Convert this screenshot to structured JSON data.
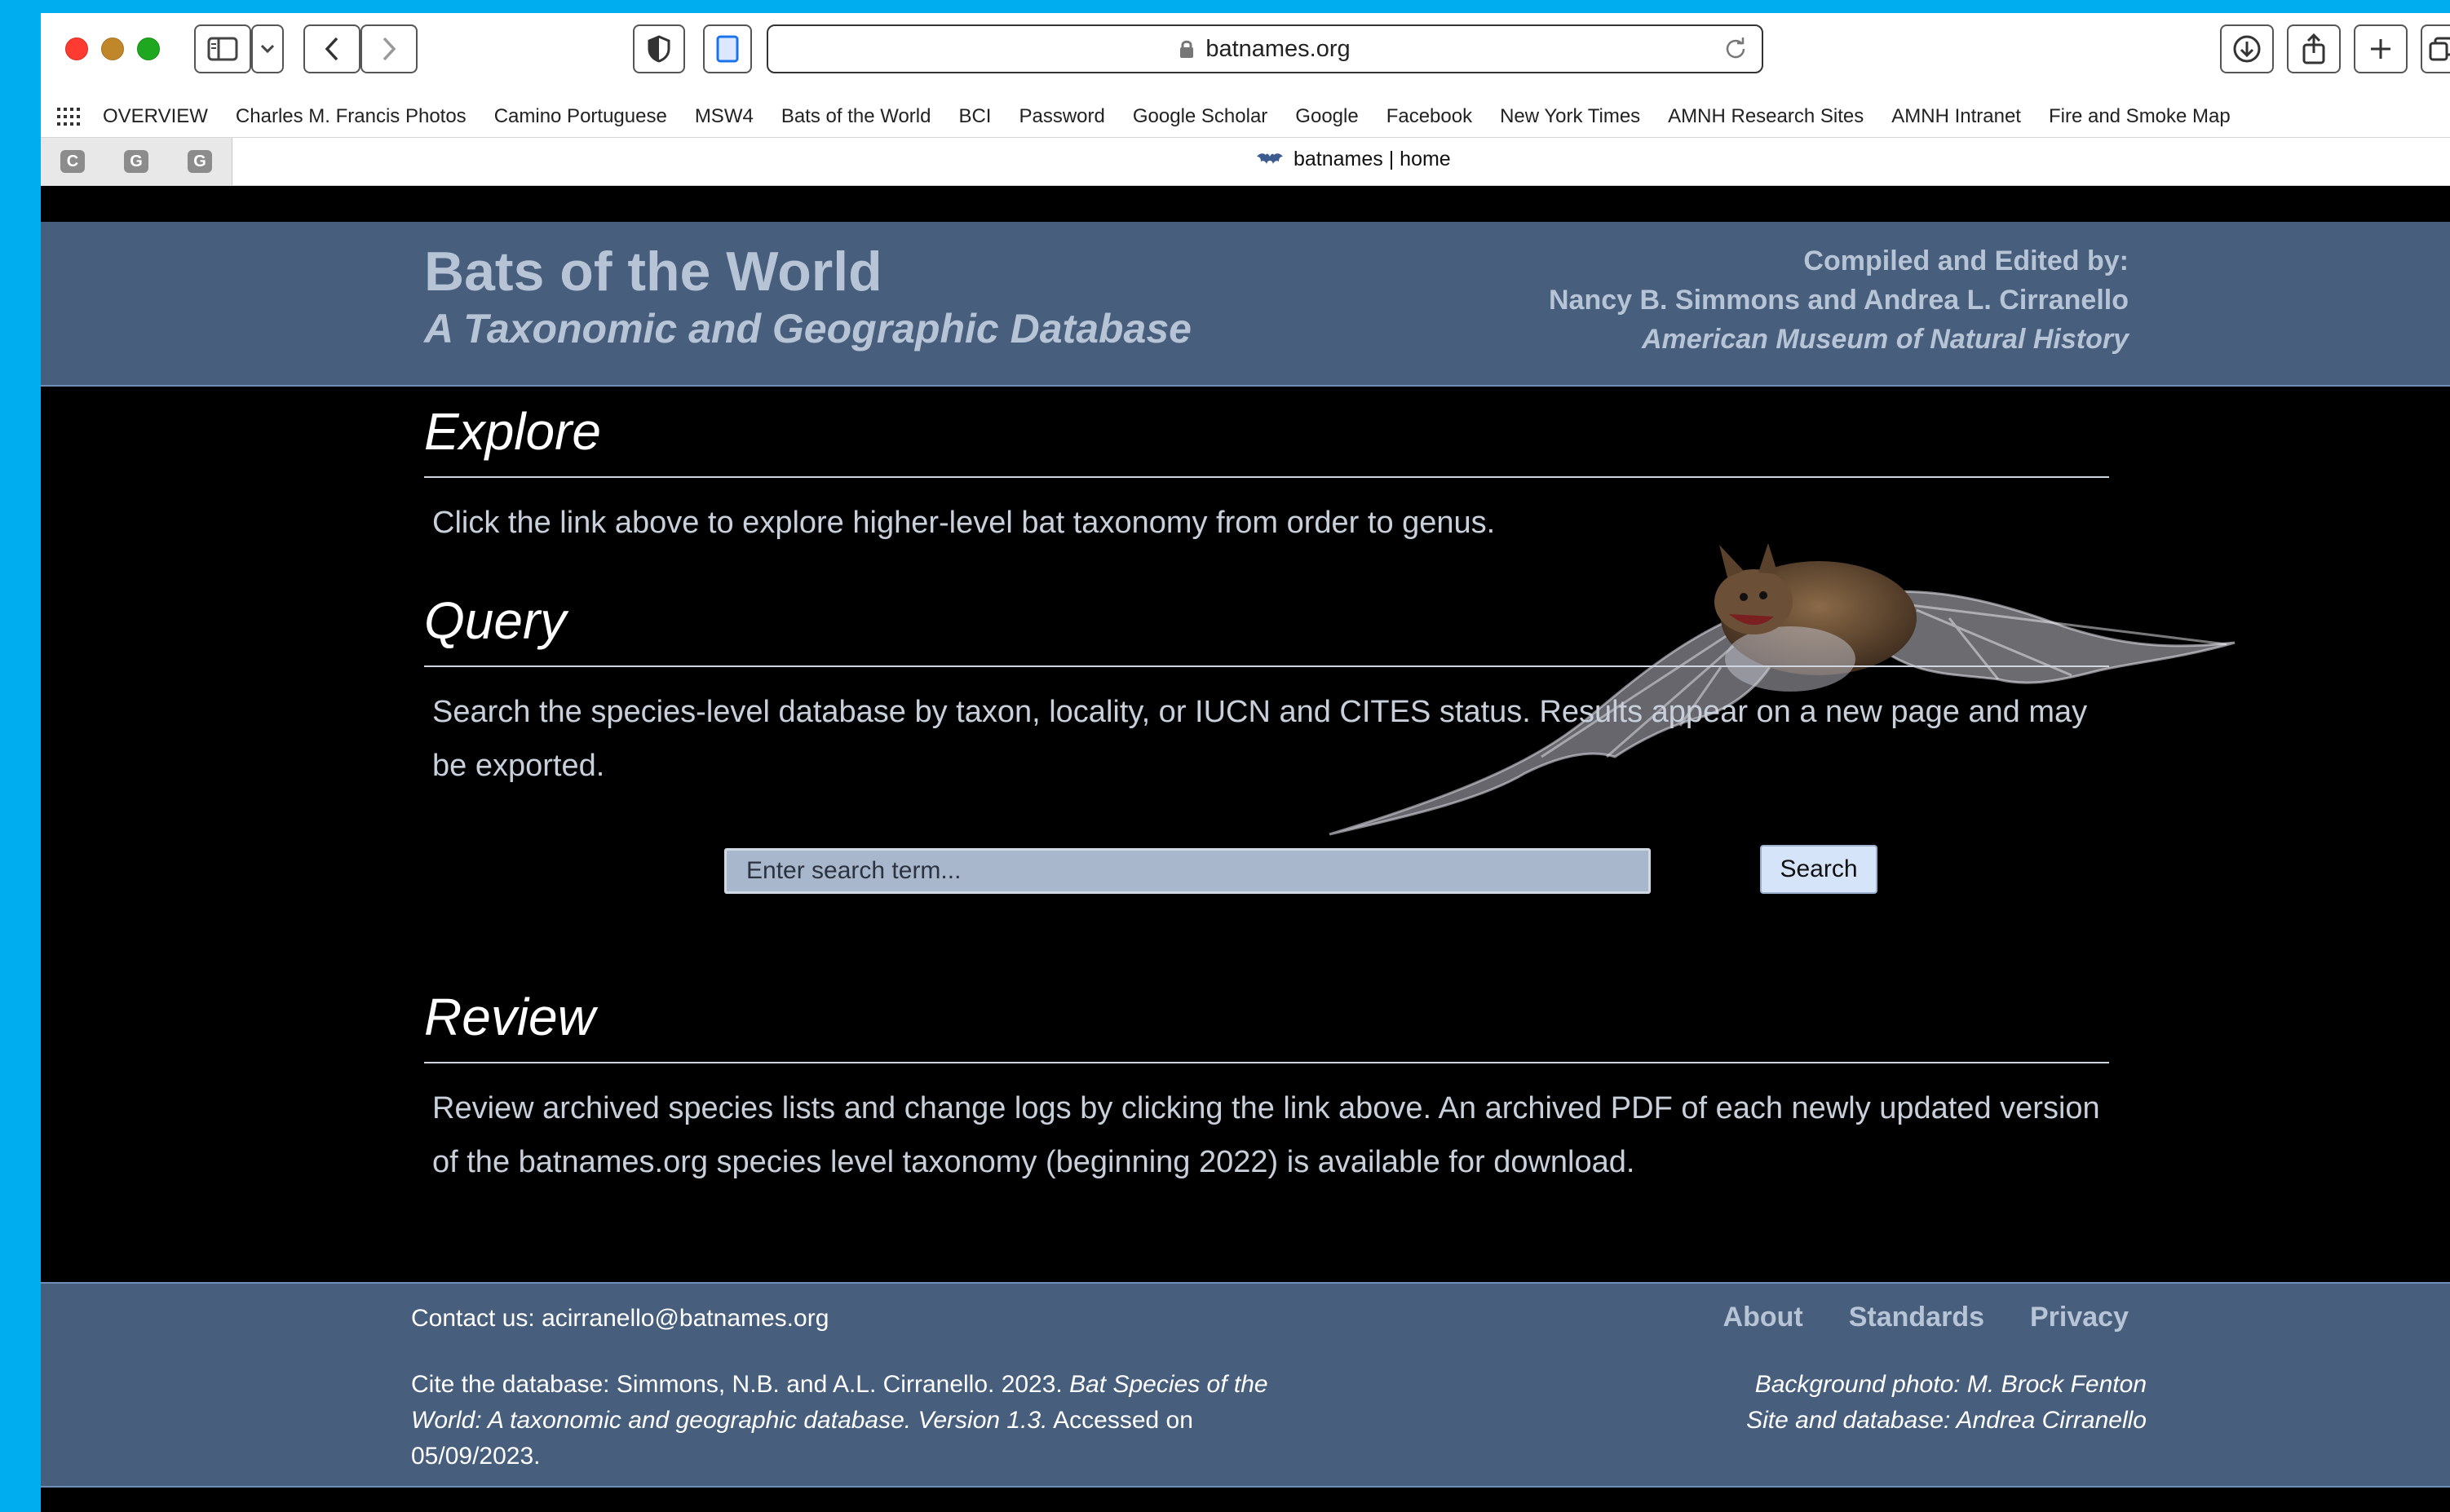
{
  "browser": {
    "address": "batnames.org",
    "bookmarks": [
      "OVERVIEW",
      "Charles M. Francis Photos",
      "Camino Portuguese",
      "MSW4",
      "Bats of the World",
      "BCI",
      "Password",
      "Google Scholar",
      "Google",
      "Facebook",
      "New York Times",
      "AMNH Research Sites",
      "AMNH Intranet",
      "Fire and Smoke Map"
    ],
    "pinned_tabs": [
      "C",
      "G",
      "G"
    ],
    "active_tab_title": "batnames | home",
    "colors": {
      "desktop": "#00aeef",
      "close": "#fe3b30",
      "minimize": "#c0862a",
      "zoom": "#1fa81f"
    }
  },
  "header": {
    "title": "Bats of the World",
    "subtitle": "A Taxonomic and Geographic Database",
    "credits_heading": "Compiled and Edited by:",
    "credits_names": "Nancy B. Simmons and Andrea L. Cirranello",
    "credits_institution": "American Museum of Natural History",
    "band_color": "#475e7c"
  },
  "sections": {
    "explore": {
      "title": "Explore",
      "text": "Click the link above to explore higher-level bat taxonomy from order to genus."
    },
    "query": {
      "title": "Query",
      "text": "Search the species-level database by taxon, locality, or IUCN and CITES status. Results appear on a new page and may be exported."
    },
    "review": {
      "title": "Review",
      "text": "Review archived species lists and change logs by clicking the link above. An archived PDF of each newly updated version of the batnames.org species level taxonomy (beginning 2022) is available for download."
    }
  },
  "search": {
    "placeholder": "Enter search term...",
    "button": "Search"
  },
  "footer": {
    "contact": "Contact us: acirranello@batnames.org",
    "cite_prefix": "Cite the database: Simmons, N.B. and A.L. Cirranello. 2023. ",
    "cite_title": "Bat Species of the World: A taxonomic and geographic database. Version 1.3.",
    "cite_suffix": " Accessed on 05/09/2023.",
    "links": [
      "About",
      "Standards",
      "Privacy"
    ],
    "photo_credit": "Background photo: M. Brock Fenton",
    "site_credit": "Site and database: Andrea Cirranello"
  }
}
